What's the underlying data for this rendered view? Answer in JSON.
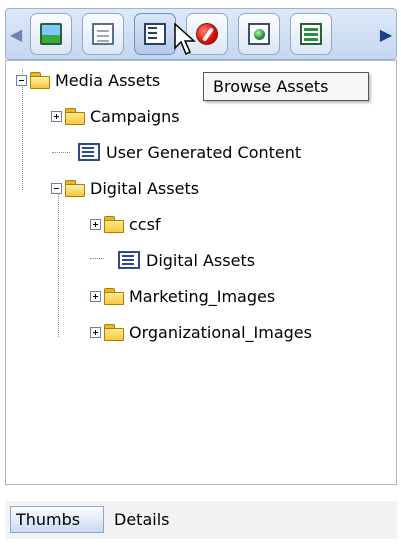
{
  "toolbar": {
    "buttons": [
      {
        "icon": "image-icon"
      },
      {
        "icon": "document-icon"
      },
      {
        "icon": "browse-assets-icon",
        "active": true
      },
      {
        "icon": "red-circle-icon"
      },
      {
        "icon": "globe-document-icon"
      },
      {
        "icon": "table-icon"
      }
    ]
  },
  "tooltip": {
    "text": "Browse Assets"
  },
  "tree": {
    "root": "Media Assets",
    "campaigns": "Campaigns",
    "user_generated": "User Generated Content",
    "digital_assets": "Digital Assets",
    "ccsf": "ccsf",
    "digital_assets_child": "Digital Assets",
    "marketing_images": "Marketing_Images",
    "organizational_images": "Organizational_Images"
  },
  "tabs": {
    "thumbs": "Thumbs",
    "details": "Details"
  },
  "colors": {
    "toolbar_bg": "#c4d7f0",
    "folder": "#f7c83d",
    "tooltip_bg": "#f7f7f7"
  }
}
